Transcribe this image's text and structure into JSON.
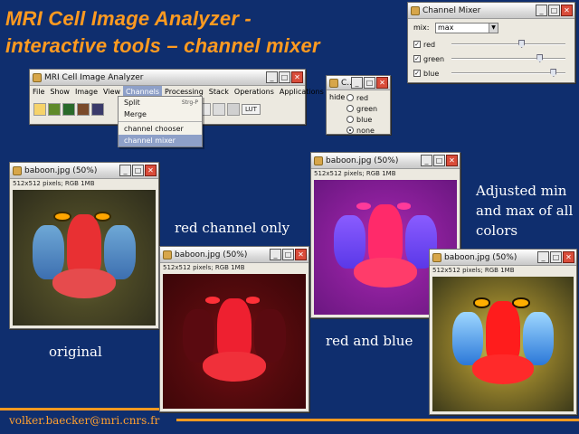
{
  "slide": {
    "title_line1": "MRI Cell Image Analyzer -",
    "title_line2": "interactive tools – channel mixer",
    "footer": "volker.baecker@mri.cnrs.fr",
    "accent_color": "#ff9a20",
    "background_color": "#0f2e6e"
  },
  "captions": {
    "original": "original",
    "red_only": "red channel only",
    "red_blue": "red and blue",
    "adjusted": "Adjusted min and max of all colors"
  },
  "analyzer": {
    "title": "MRI Cell Image Analyzer",
    "menu": [
      "File",
      "Show",
      "Image",
      "View",
      "Channels",
      "Processing",
      "Stack",
      "Operations",
      "Applications"
    ],
    "toolbar_button": "LUT",
    "channels_menu": {
      "split": "Split",
      "split_shortcut": "Strg-P",
      "merge": "Merge",
      "channel_chooser": "channel chooser",
      "channel_mixer": "channel mixer"
    }
  },
  "chooser": {
    "title": "C...",
    "hide_label": "hide",
    "options": [
      "red",
      "green",
      "blue",
      "none"
    ],
    "selected": "none"
  },
  "mixer": {
    "title": "Channel Mixer",
    "mix_label": "mix:",
    "mix_value": "max",
    "channels": [
      {
        "label": "red",
        "checked": true,
        "level": 0.62
      },
      {
        "label": "green",
        "checked": true,
        "level": 0.78
      },
      {
        "label": "blue",
        "checked": true,
        "level": 0.9
      }
    ]
  },
  "image_windows": [
    {
      "id": "orig",
      "title": "baboon.jpg (50%)",
      "info": "512x512 pixels; RGB 1MB"
    },
    {
      "id": "redonly",
      "title": "baboon.jpg (50%)",
      "info": "512x512 pixels; RGB 1MB"
    },
    {
      "id": "redblue",
      "title": "baboon.jpg (50%)",
      "info": "512x512 pixels; RGB 1MB"
    },
    {
      "id": "adjusted",
      "title": "baboon.jpg (50%)",
      "info": "512x512 pixels; RGB 1MB"
    }
  ],
  "icons": {
    "minimize": "minimize-icon",
    "maximize": "maximize-icon",
    "close": "close-icon"
  }
}
